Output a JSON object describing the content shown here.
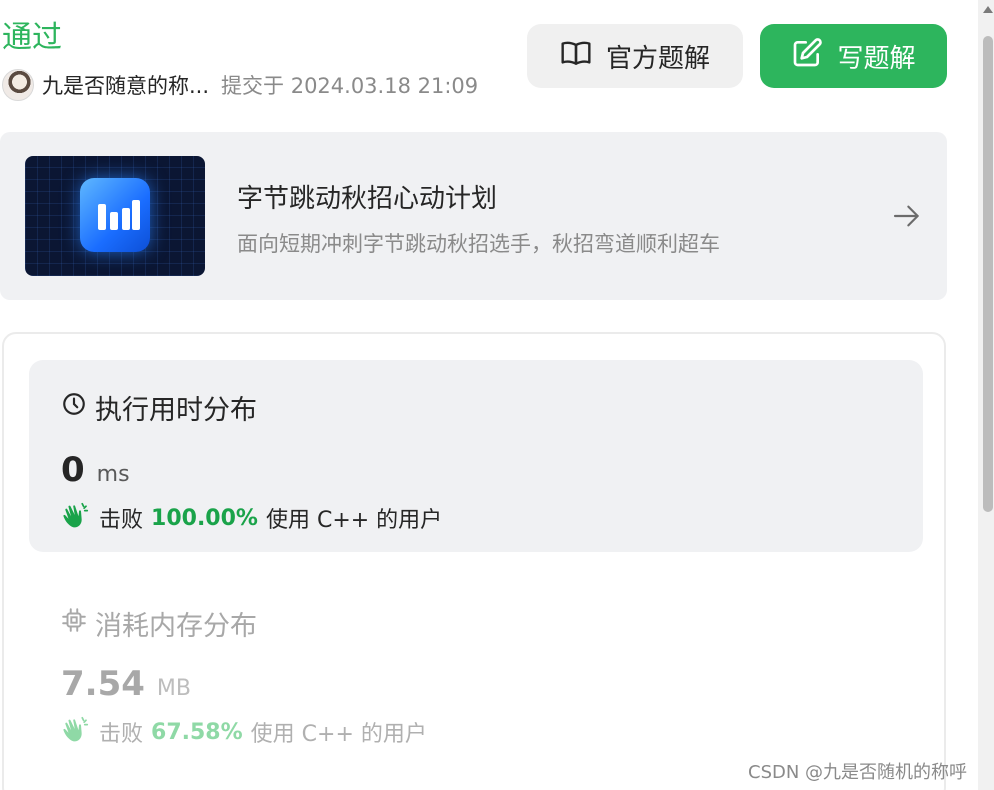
{
  "header": {
    "status": "通过",
    "user_name": "九是否随意的称...",
    "submitted_at": "提交于 2024.03.18 21:09"
  },
  "buttons": {
    "official_solution": "官方题解",
    "write_solution": "写题解"
  },
  "promo": {
    "title": "字节跳动秋招心动计划",
    "subtitle": "面向短期冲刺字节跳动秋招选手，秋招弯道顺利超车"
  },
  "runtime": {
    "heading": "执行用时分布",
    "value": "0",
    "unit": "ms",
    "beat_prefix": "击败",
    "beat_percent": "100.00%",
    "beat_suffix": "使用 C++ 的用户"
  },
  "memory": {
    "heading": "消耗内存分布",
    "value": "7.54",
    "unit": "MB",
    "beat_prefix": "击败",
    "beat_percent": "67.58%",
    "beat_suffix": "使用 C++ 的用户"
  },
  "watermark": "CSDN @九是否随机的称呼",
  "icons": {
    "book": "book-open-icon",
    "edit": "edit-icon",
    "arrow": "arrow-right-icon",
    "clock": "clock-icon",
    "chip": "chip-icon",
    "clap": "clap-icon"
  },
  "colors": {
    "accent": "#2db55d",
    "beat_green": "#1aa34a",
    "panel_bg": "#f0f1f3"
  }
}
